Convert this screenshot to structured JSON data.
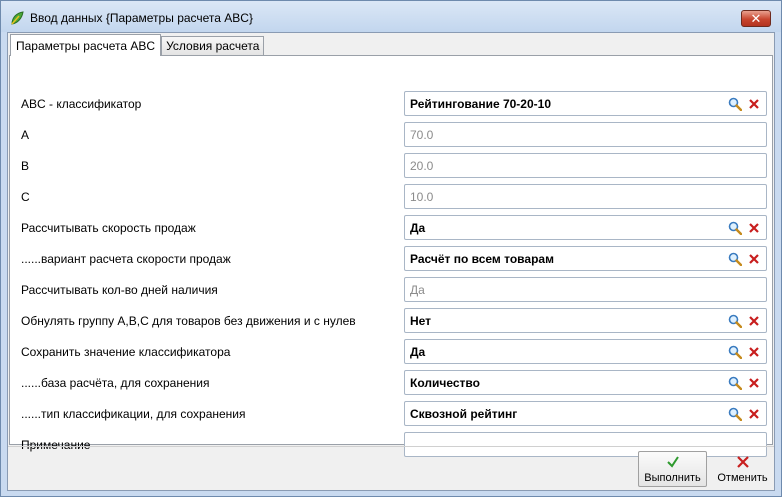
{
  "window": {
    "title": "Ввод данных {Параметры расчета ABC}",
    "close_label": "✕"
  },
  "tabs": [
    {
      "label": "Параметры расчета ABC",
      "active": true
    },
    {
      "label": "Условия расчета",
      "active": false
    }
  ],
  "fields": [
    {
      "label": "ABC - классификатор",
      "value": "Рейтингование 70-20-10",
      "readonly": false,
      "lookup": true
    },
    {
      "label": "A",
      "value": "70.0",
      "readonly": true,
      "lookup": false
    },
    {
      "label": "B",
      "value": "20.0",
      "readonly": true,
      "lookup": false
    },
    {
      "label": "C",
      "value": "10.0",
      "readonly": true,
      "lookup": false
    },
    {
      "label": "Рассчитывать скорость продаж",
      "value": "Да",
      "readonly": false,
      "lookup": true
    },
    {
      "label": "......вариант расчета скорости продаж",
      "value": "Расчёт по всем товарам",
      "readonly": false,
      "lookup": true
    },
    {
      "label": "Рассчитывать кол-во дней наличия",
      "value": "Да",
      "readonly": true,
      "lookup": false
    },
    {
      "label": "Обнулять группу A,B,C для товаров без движения и с нулев",
      "value": "Нет",
      "readonly": false,
      "lookup": true
    },
    {
      "label": "Сохранить значение классификатора",
      "value": "Да",
      "readonly": false,
      "lookup": true
    },
    {
      "label": "......база расчёта, для сохранения",
      "value": "Количество",
      "readonly": false,
      "lookup": true
    },
    {
      "label": "......тип классификации, для сохранения",
      "value": "Сквозной рейтинг",
      "readonly": false,
      "lookup": true
    },
    {
      "label": "Примечание",
      "value": "",
      "readonly": false,
      "lookup": false
    }
  ],
  "buttons": {
    "ok_label": "Выполнить",
    "cancel_label": "Отменить"
  },
  "icons": {
    "search": "magnifier-icon",
    "clear": "red-x-icon",
    "ok": "green-check-icon",
    "cancel": "red-x-icon"
  },
  "colors": {
    "accent": "#c9daf0",
    "ok": "#2e9a2e",
    "cancel": "#c81e1e"
  }
}
